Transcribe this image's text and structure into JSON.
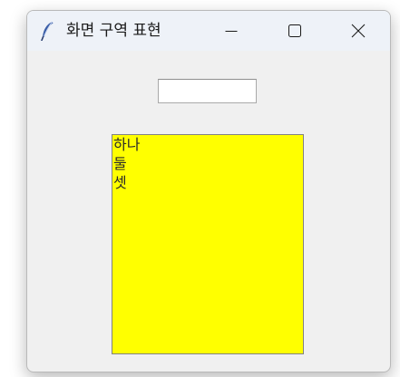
{
  "window": {
    "title": "화면 구역 표현",
    "app_icon": "feather-icon",
    "controls": {
      "minimize_icon": "minimize-icon",
      "maximize_icon": "maximize-icon",
      "close_icon": "close-icon"
    }
  },
  "entry": {
    "value": ""
  },
  "listbox": {
    "background": "#ffff00",
    "items": [
      "하나",
      "둘",
      "셋"
    ]
  }
}
